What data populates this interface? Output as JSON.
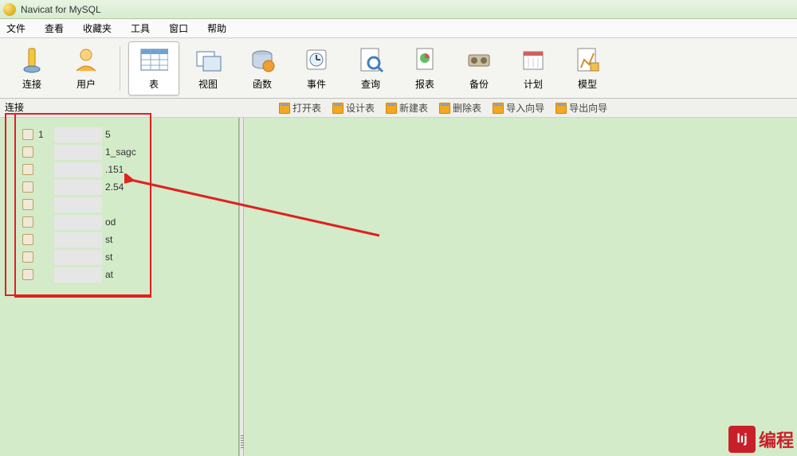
{
  "title": "Navicat for MySQL",
  "menu": [
    "文件",
    "查看",
    "收藏夹",
    "工具",
    "窗口",
    "帮助"
  ],
  "toolbar": [
    {
      "label": "连接",
      "icon": "connection-icon"
    },
    {
      "label": "用户",
      "icon": "user-icon"
    },
    {
      "label": "表",
      "icon": "table-icon",
      "active": true
    },
    {
      "label": "视图",
      "icon": "view-icon"
    },
    {
      "label": "函数",
      "icon": "function-icon"
    },
    {
      "label": "事件",
      "icon": "event-icon"
    },
    {
      "label": "查询",
      "icon": "query-icon"
    },
    {
      "label": "报表",
      "icon": "report-icon"
    },
    {
      "label": "备份",
      "icon": "backup-icon"
    },
    {
      "label": "计划",
      "icon": "schedule-icon"
    },
    {
      "label": "模型",
      "icon": "model-icon"
    }
  ],
  "subtoolbar": [
    "打开表",
    "设计表",
    "新建表",
    "删除表",
    "导入向导",
    "导出向导"
  ],
  "conn_label": "连接",
  "tree": [
    {
      "prefix": "1",
      "suffix": "5"
    },
    {
      "prefix": "",
      "suffix": "1_sagc"
    },
    {
      "prefix": "",
      "suffix": ".151"
    },
    {
      "prefix": "",
      "suffix": "2.54"
    },
    {
      "prefix": "",
      "suffix": ""
    },
    {
      "prefix": "",
      "suffix": "od"
    },
    {
      "prefix": "",
      "suffix": "st"
    },
    {
      "prefix": "",
      "suffix": "st"
    },
    {
      "prefix": "",
      "suffix": "at"
    }
  ],
  "watermark": {
    "badge": "lıj",
    "text": "编程"
  }
}
